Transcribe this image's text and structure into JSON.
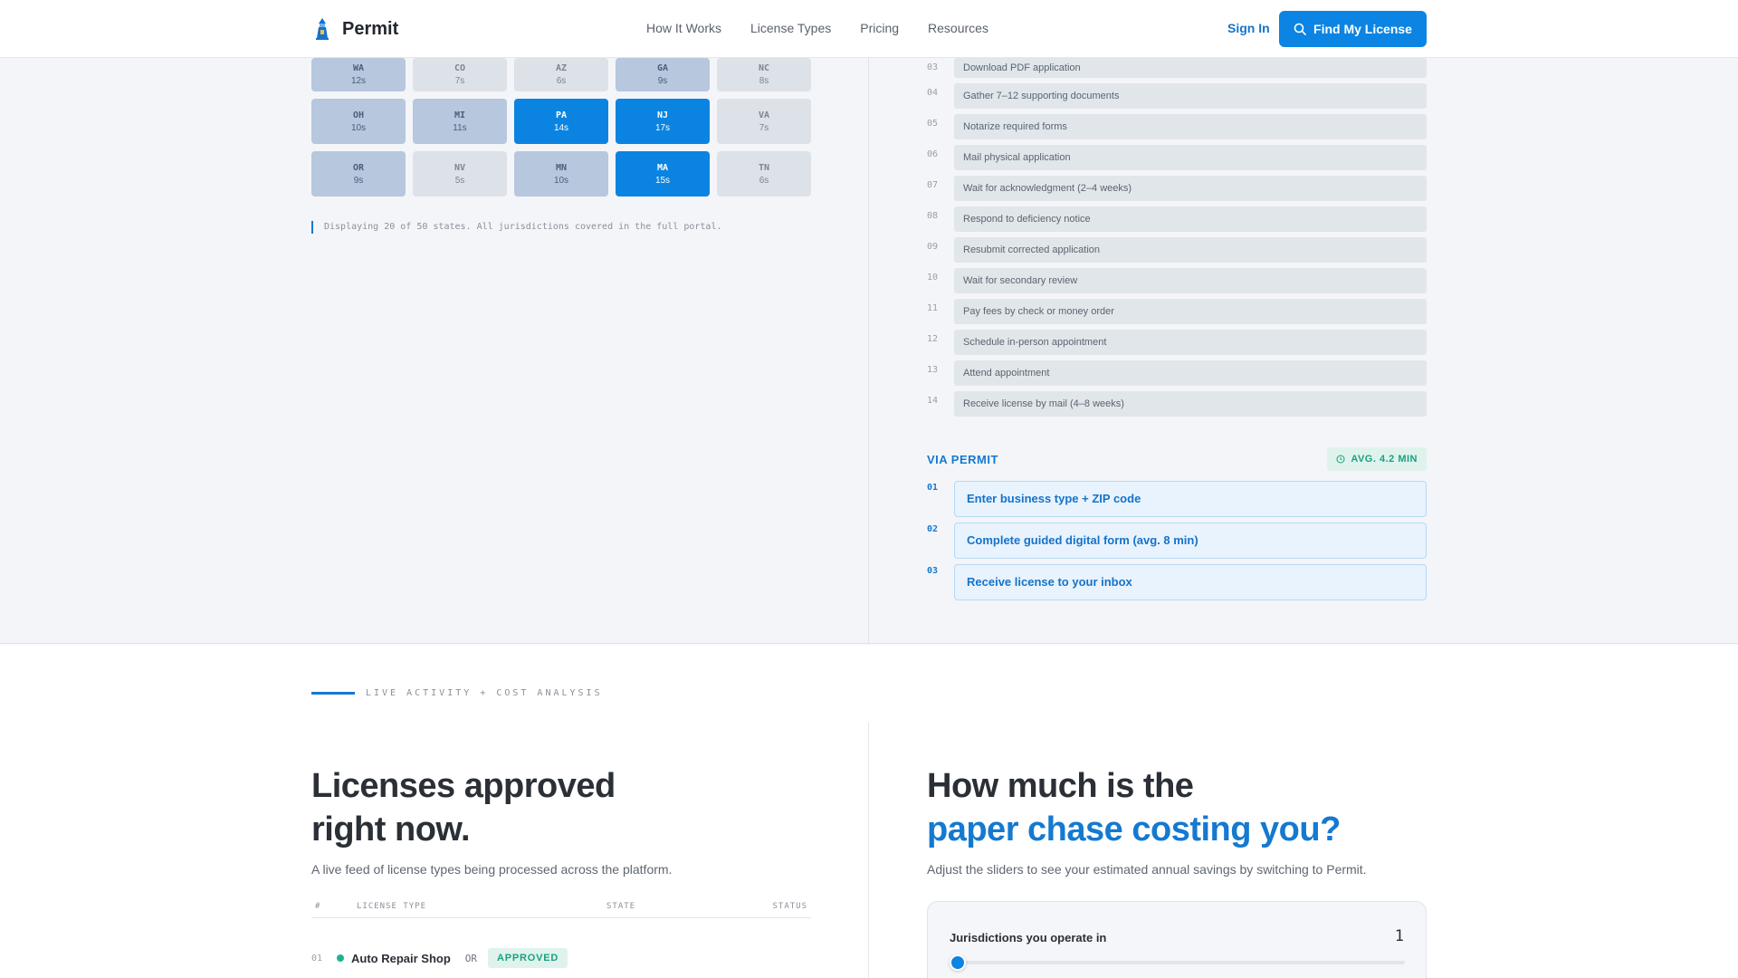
{
  "nav": {
    "brand": "Permit",
    "links": [
      "How It Works",
      "License Types",
      "Pricing",
      "Resources"
    ],
    "signin": "Sign In",
    "cta": "Find My License"
  },
  "states": [
    {
      "code": "WA",
      "time": "12s",
      "level": 2
    },
    {
      "code": "CO",
      "time": "7s",
      "level": 1
    },
    {
      "code": "AZ",
      "time": "6s",
      "level": 1
    },
    {
      "code": "GA",
      "time": "9s",
      "level": 2
    },
    {
      "code": "NC",
      "time": "8s",
      "level": 1
    },
    {
      "code": "OH",
      "time": "10s",
      "level": 2
    },
    {
      "code": "MI",
      "time": "11s",
      "level": 2
    },
    {
      "code": "PA",
      "time": "14s",
      "level": 3
    },
    {
      "code": "NJ",
      "time": "17s",
      "level": 3
    },
    {
      "code": "VA",
      "time": "7s",
      "level": 1
    },
    {
      "code": "OR",
      "time": "9s",
      "level": 2
    },
    {
      "code": "NV",
      "time": "5s",
      "level": 1
    },
    {
      "code": "MN",
      "time": "10s",
      "level": 2
    },
    {
      "code": "MA",
      "time": "15s",
      "level": 3
    },
    {
      "code": "TN",
      "time": "6s",
      "level": 1
    }
  ],
  "grid_note": "Displaying 20 of 50 states. All jurisdictions covered in the full portal.",
  "old_steps": [
    {
      "num": "03",
      "label": "Download PDF application"
    },
    {
      "num": "04",
      "label": "Gather 7–12 supporting documents"
    },
    {
      "num": "05",
      "label": "Notarize required forms"
    },
    {
      "num": "06",
      "label": "Mail physical application"
    },
    {
      "num": "07",
      "label": "Wait for acknowledgment (2–4 weeks)"
    },
    {
      "num": "08",
      "label": "Respond to deficiency notice"
    },
    {
      "num": "09",
      "label": "Resubmit corrected application"
    },
    {
      "num": "10",
      "label": "Wait for secondary review"
    },
    {
      "num": "11",
      "label": "Pay fees by check or money order"
    },
    {
      "num": "12",
      "label": "Schedule in-person appointment"
    },
    {
      "num": "13",
      "label": "Attend appointment"
    },
    {
      "num": "14",
      "label": "Receive license by mail (4–8 weeks)"
    }
  ],
  "via": {
    "title": "VIA PERMIT",
    "badge": "AVG. 4.2 MIN",
    "steps": [
      {
        "num": "01",
        "label": "Enter business type + ZIP code"
      },
      {
        "num": "02",
        "label": "Complete guided digital form (avg. 8 min)"
      },
      {
        "num": "03",
        "label": "Receive license to your inbox"
      }
    ]
  },
  "live": {
    "eyebrow": "LIVE ACTIVITY + COST ANALYSIS",
    "title_l1": "Licenses approved",
    "title_l2": "right now.",
    "subtitle": "A live feed of license types being processed across the platform.",
    "headers": {
      "num": "#",
      "type": "LICENSE TYPE",
      "state": "STATE",
      "status": "STATUS"
    },
    "rows": [
      {
        "idx": "01",
        "license": "Auto Repair Shop",
        "state": "OR",
        "status": "APPROVED"
      }
    ]
  },
  "calc": {
    "title_l1": "How much is the",
    "title_l2": "paper chase costing you?",
    "subtitle": "Adjust the sliders to see your estimated annual savings by switching to Permit.",
    "slider_label": "Jurisdictions you operate in",
    "slider_value": "1"
  },
  "colors": {
    "accent": "#0b84e3",
    "success": "#1aa184"
  },
  "icons": {
    "brand": "lighthouse-icon",
    "search": "search-icon",
    "badge": "clock-icon"
  }
}
